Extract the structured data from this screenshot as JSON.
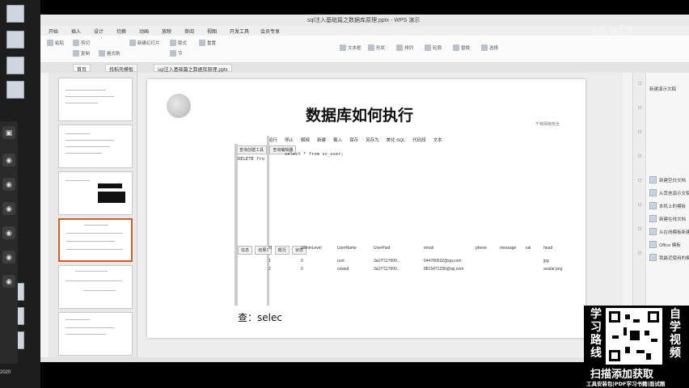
{
  "window": {
    "title": "sql注入基础篇之数据库原理.pptx - WPS 演示",
    "menus": [
      "开始",
      "插入",
      "设计",
      "切换",
      "动画",
      "放映",
      "审阅",
      "视图",
      "开发工具",
      "会员专享"
    ]
  },
  "ribbon": [
    "粘贴",
    "剪切",
    "复制",
    "格式刷",
    "新建幻灯片",
    "版式",
    "节",
    "重置",
    "文本框",
    "形状",
    "排列",
    "轮廓",
    "替换",
    "选择"
  ],
  "doc_tabs": [
    "首页",
    "找稻壳模板",
    "sql注入基础篇之数据库原理.pptx"
  ],
  "slide": {
    "title": "数据库如何执行",
    "brand": "千锋网络安全",
    "bottom_text": "查：selec"
  },
  "navicat": {
    "toolbar": [
      "运行",
      "停止",
      "解释",
      "新建",
      "载入",
      "保存",
      "另存为",
      "美化 SQL",
      "代码段",
      "文本"
    ],
    "query_tabs": [
      "查询创建工具",
      "查询编辑器"
    ],
    "sql_left": "DELETE fro",
    "sql_main": "select * from sc_user;",
    "result_tabs": [
      "信息",
      "结果1",
      "概况",
      "状态"
    ],
    "columns": [
      "id",
      "adminLevel",
      "UserName",
      "UserPwd",
      "email",
      "phone",
      "message",
      "sal",
      "head"
    ],
    "rows": [
      {
        "id": "1",
        "level": "0",
        "name": "root",
        "pwd": "3a1f7117600...",
        "email": "644780032@qq.com",
        "head": "jpg"
      },
      {
        "id": "2",
        "level": "0",
        "name": "cowed",
        "pwd": "3a1f7117600...",
        "email": "8815471236@qq.com",
        "head": "avatar.png"
      }
    ]
  },
  "right_pane": {
    "header": "新建演示文稿",
    "items": [
      "新建空白文档",
      "从其他演示文稿新建",
      "本机上的模板",
      "新建在线文档",
      "从在线模板新建",
      "Office 模板",
      "我最近使用的模板"
    ]
  },
  "promo": {
    "left_chars": [
      "学",
      "习",
      "路",
      "线"
    ],
    "right_chars": [
      "自",
      "学",
      "视",
      "频"
    ],
    "cta": "扫描添加获取",
    "sub": "工具安装包|PDF学习书籍|面试题"
  },
  "watermark": "头条 @千锋",
  "caption": "2020"
}
